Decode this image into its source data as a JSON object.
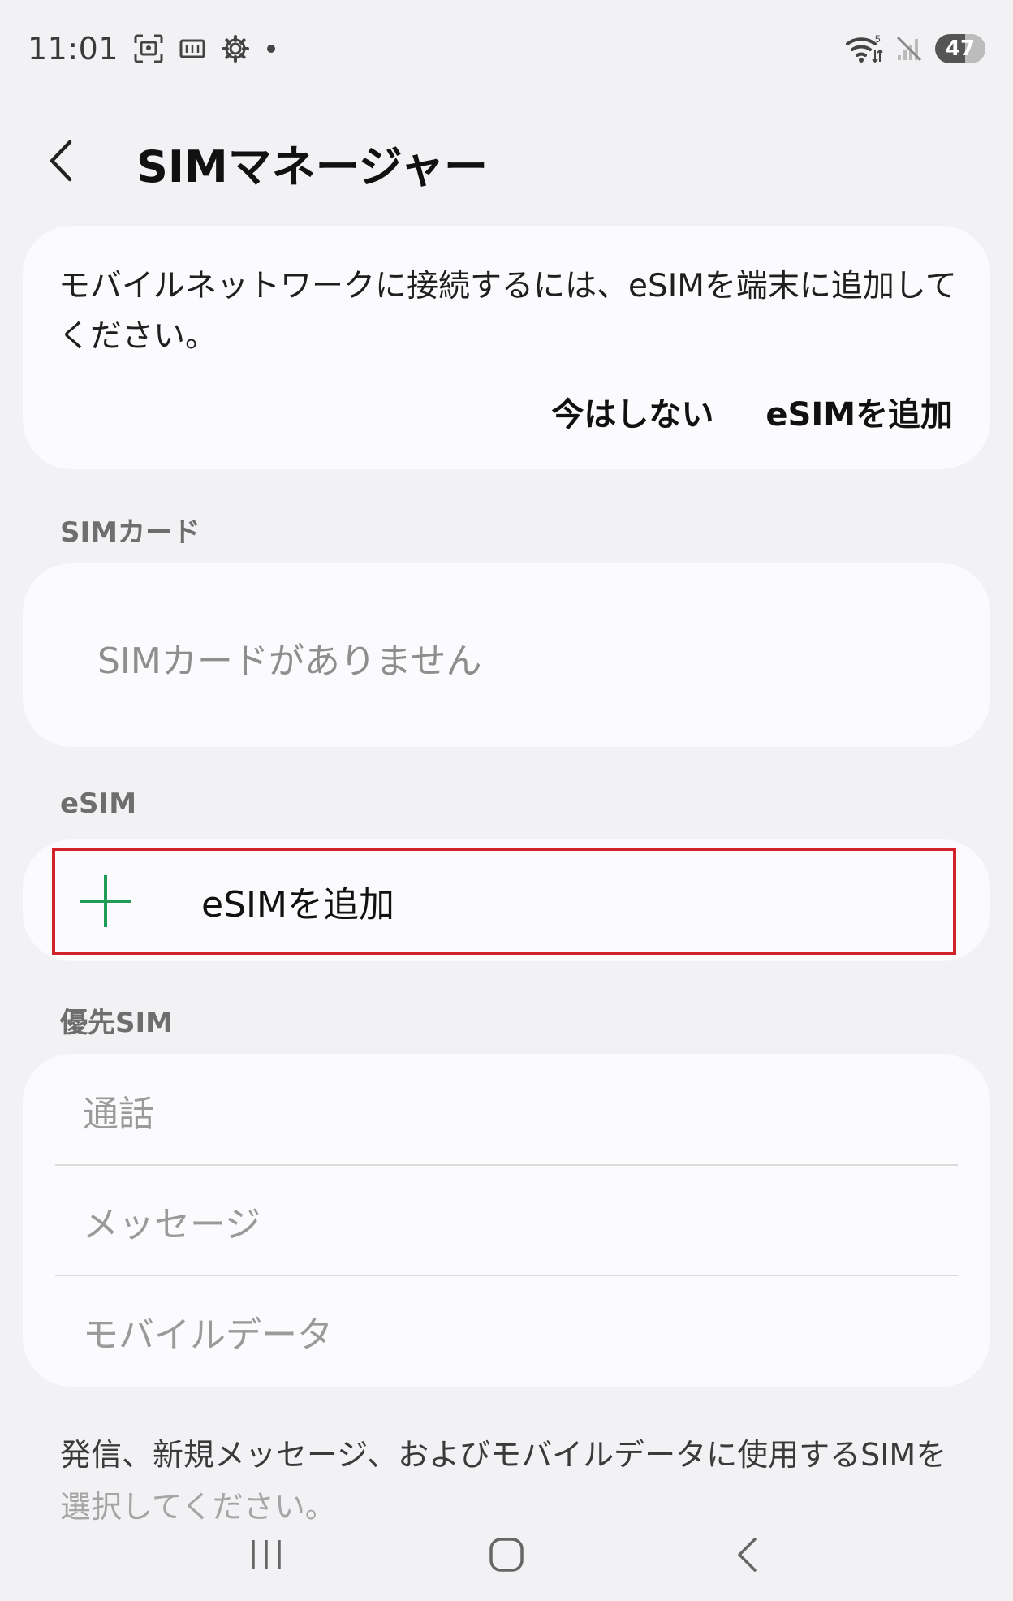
{
  "status_bar": {
    "time": "11:01",
    "battery_level": "47",
    "icons": [
      "screenshot-icon",
      "cast-icon",
      "settings-gear-icon",
      "notification-dot-icon",
      "wifi-icon",
      "no-signal-icon",
      "battery-icon"
    ],
    "wifi_badge": "5"
  },
  "header": {
    "title": "SIMマネージャー",
    "back_icon": "chevron-left-icon"
  },
  "notice": {
    "text": "モバイルネットワークに接続するには、eSIMを端末に追加してください。",
    "dismiss_label": "今はしない",
    "add_label": "eSIMを追加"
  },
  "sim_section": {
    "label": "SIMカード",
    "empty_text": "SIMカードがありません"
  },
  "esim_section": {
    "label": "eSIM",
    "add_label": "eSIMを追加",
    "add_icon": "plus-icon",
    "accent_color": "#1e9b54",
    "highlight_color": "#d2232a"
  },
  "priority_section": {
    "label": "優先SIM",
    "items": [
      "通話",
      "メッセージ",
      "モバイルデータ"
    ]
  },
  "footer": {
    "text_main": "発信、新規メッセージ、およびモバイルデータに使用するSIMを",
    "text_fade": "選択してください。"
  },
  "nav_bar": {
    "icons": [
      "recent-apps-icon",
      "home-icon",
      "back-icon"
    ]
  }
}
